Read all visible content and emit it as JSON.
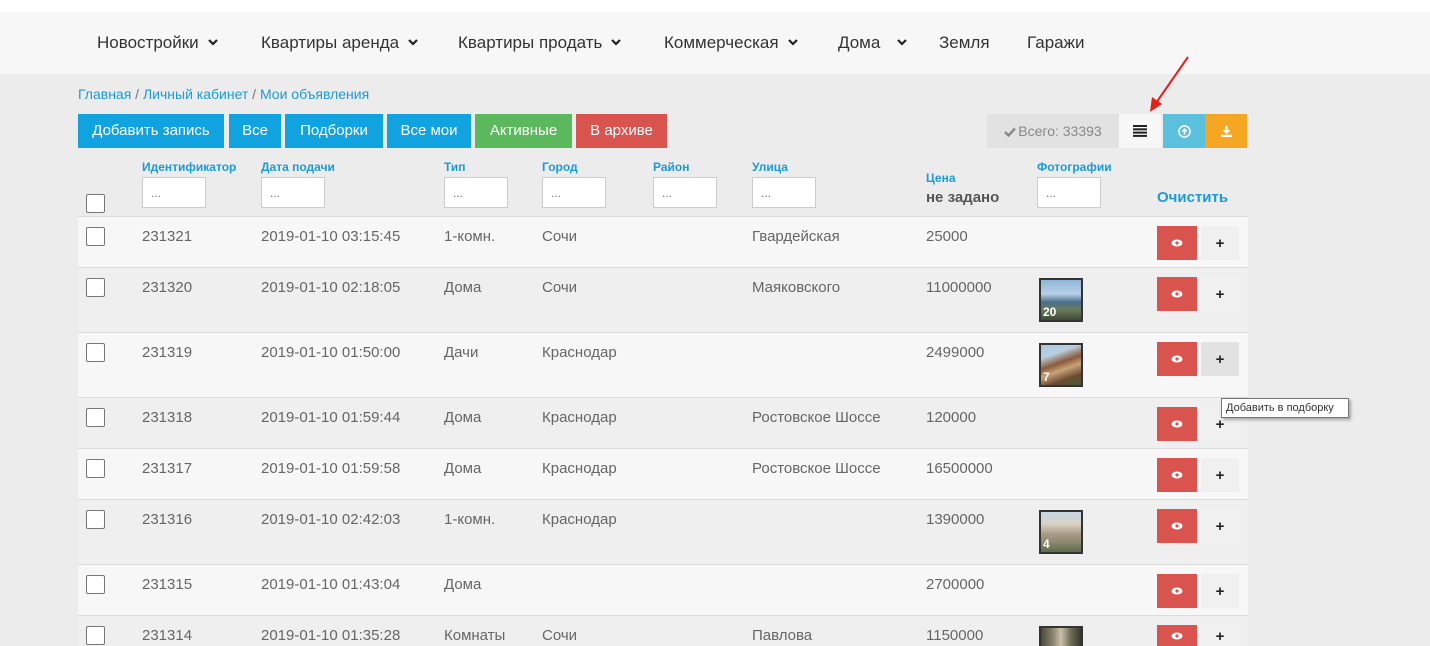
{
  "nav": {
    "items": [
      {
        "label": "Новостройки",
        "dropdown": true
      },
      {
        "label": "Квартиры аренда",
        "dropdown": true
      },
      {
        "label": "Квартиры продать",
        "dropdown": true
      },
      {
        "label": "Коммерческая",
        "dropdown": true
      },
      {
        "label": "Дома",
        "dropdown": true
      },
      {
        "label": "Земля",
        "dropdown": false
      },
      {
        "label": "Гаражи",
        "dropdown": false
      }
    ]
  },
  "breadcrumb": {
    "home": "Главная",
    "sep": " / ",
    "cabinet": "Личный кабинет",
    "current": "Мои объявления"
  },
  "toolbar": {
    "add": "Добавить запись",
    "all": "Все",
    "collections": "Подборки",
    "all_mine": "Все мои",
    "active": "Активные",
    "archive": "В архиве",
    "total": "Всего: 33393",
    "icons": [
      "check-icon",
      "list-icon",
      "upload-icon",
      "download-icon"
    ]
  },
  "table": {
    "headers": {
      "id": "Идентификатор",
      "date": "Дата подачи",
      "type": "Тип",
      "city": "Город",
      "district": "Район",
      "street": "Улица",
      "price": "Цена",
      "price_sub": "не задано",
      "photos": "Фотографии",
      "clear": "Очистить"
    },
    "filter_placeholder": "...",
    "rows": [
      {
        "id": "231321",
        "date": "2019-01-10 03:15:45",
        "type": "1-комн.",
        "city": "Сочи",
        "street": "Гвардейская",
        "price": "25000",
        "photos": ""
      },
      {
        "id": "231320",
        "date": "2019-01-10 02:18:05",
        "type": "Дома",
        "city": "Сочи",
        "street": "Маяковского",
        "price": "11000000",
        "photos": "20"
      },
      {
        "id": "231319",
        "date": "2019-01-10 01:50:00",
        "type": "Дачи",
        "city": "Краснодар",
        "street": "",
        "price": "2499000",
        "photos": "7"
      },
      {
        "id": "231318",
        "date": "2019-01-10 01:59:44",
        "type": "Дома",
        "city": "Краснодар",
        "street": "Ростовское Шоссе",
        "price": "120000",
        "photos": ""
      },
      {
        "id": "231317",
        "date": "2019-01-10 01:59:58",
        "type": "Дома",
        "city": "Краснодар",
        "street": "Ростовское Шоссе",
        "price": "16500000",
        "photos": ""
      },
      {
        "id": "231316",
        "date": "2019-01-10 02:42:03",
        "type": "1-комн.",
        "city": "Краснодар",
        "street": "",
        "price": "1390000",
        "photos": "4"
      },
      {
        "id": "231315",
        "date": "2019-01-10 01:43:04",
        "type": "Дома",
        "city": "",
        "street": "",
        "price": "2700000",
        "photos": ""
      },
      {
        "id": "231314",
        "date": "2019-01-10 01:35:28",
        "type": "Комнаты",
        "city": "Сочи",
        "street": "Павлова",
        "price": "1150000",
        "photos": ""
      }
    ]
  },
  "tooltip": "Добавить в подборку",
  "colors": {
    "accent": "#11a3e0",
    "success": "#5cb85c",
    "danger": "#d9534f",
    "info": "#5bc0de",
    "warning": "#f5a623"
  }
}
